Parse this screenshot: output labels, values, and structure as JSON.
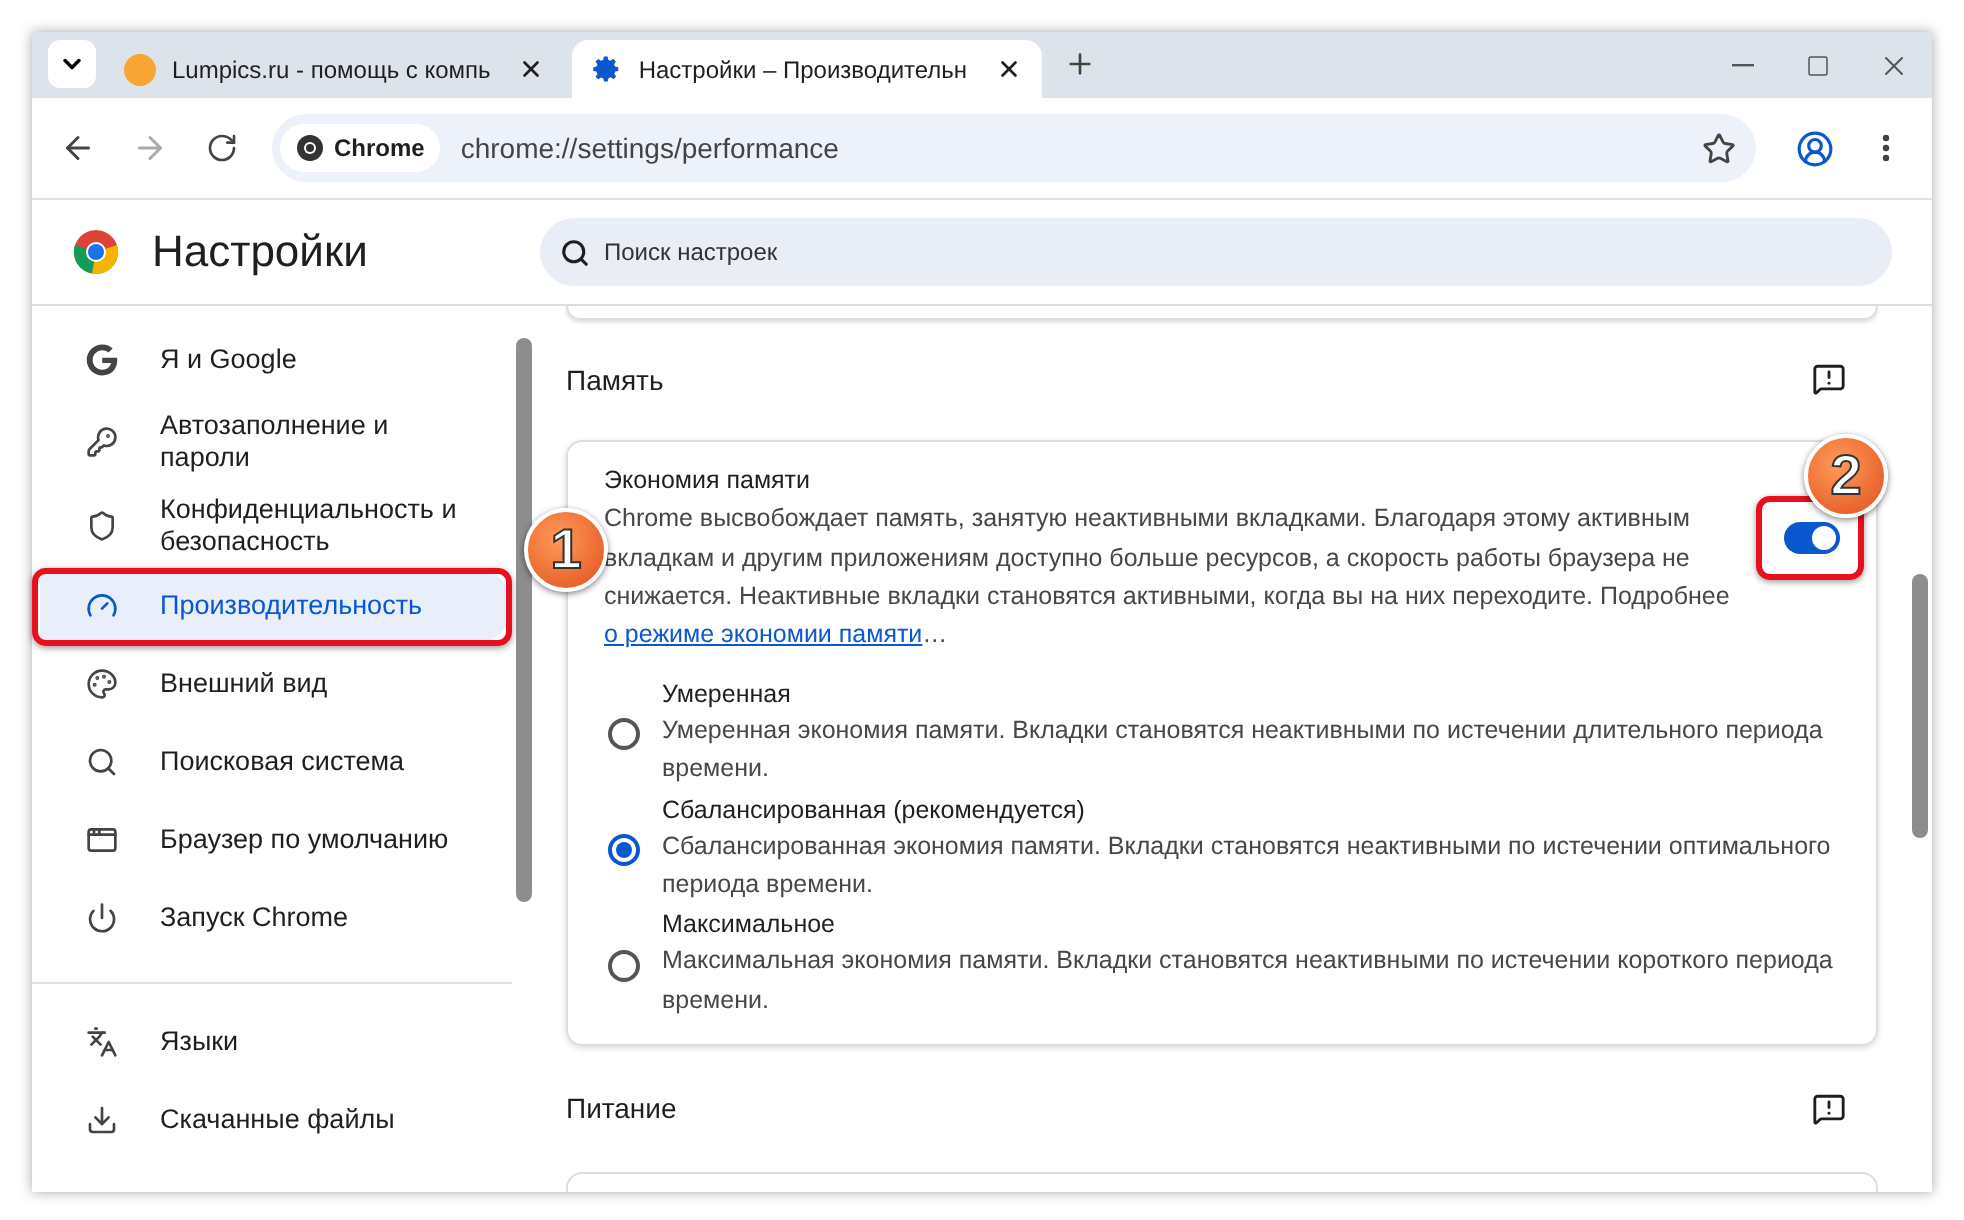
{
  "tabs": [
    {
      "title": "Lumpics.ru - помощь с компь",
      "selected": false
    },
    {
      "title": "Настройки – Производительн",
      "selected": true
    }
  ],
  "address_bar": {
    "chip": "Chrome",
    "url": "chrome://settings/performance"
  },
  "header": {
    "title": "Настройки",
    "search": {
      "placeholder": "Поиск настроек"
    }
  },
  "sidebar": {
    "groups": [
      {
        "items": [
          {
            "label": "Я и Google",
            "selected": false
          },
          {
            "label": "Автозаполнение и пароли",
            "selected": false
          },
          {
            "label": "Конфиденциальность и безопасность",
            "selected": false
          },
          {
            "label": "Производительность",
            "selected": true
          },
          {
            "label": "Внешний вид",
            "selected": false
          },
          {
            "label": "Поисковая система",
            "selected": false
          },
          {
            "label": "Браузер по умолчанию",
            "selected": false
          },
          {
            "label": "Запуск Chrome",
            "selected": false
          }
        ]
      },
      {
        "items": [
          {
            "label": "Языки",
            "selected": false
          },
          {
            "label": "Скачанные файлы",
            "selected": false
          }
        ]
      }
    ]
  },
  "sections": [
    {
      "title": "Память",
      "card": {
        "title": "Экономия памяти",
        "description": "Chrome высвобождает память, занятую неактивными вкладками. Благодаря этому активным вкладкам и другим приложениям доступно больше ресурсов, а скорость работы браузера не снижается. Неактивные вкладки становятся активными, когда вы на них переходите. Подробнее",
        "link": "о режиме экономии памяти",
        "link_suffix": "…",
        "toggle_on": true,
        "options": [
          {
            "label": "Умеренная",
            "description": "Умеренная экономия памяти. Вкладки становятся неактивными по истечении длительного периода времени.",
            "selected": false
          },
          {
            "label": "Сбалансированная (рекомендуется)",
            "description": "Сбалансированная экономия памяти. Вкладки становятся неактивными по истечении оптимального периода времени.",
            "selected": true
          },
          {
            "label": "Максимальное",
            "description": "Максимальная экономия памяти. Вкладки становятся неактивными по истечении короткого периода времени.",
            "selected": false
          }
        ]
      }
    },
    {
      "title": "Питание"
    }
  ],
  "annotations": [
    {
      "label": "1"
    },
    {
      "label": "2"
    }
  ]
}
